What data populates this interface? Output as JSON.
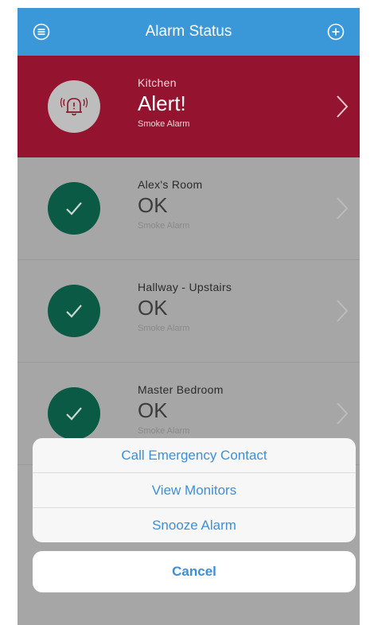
{
  "header": {
    "title": "Alarm Status",
    "left_icon": "menu-icon",
    "right_icon": "add-icon",
    "color": "#3a98d8"
  },
  "alarms": [
    {
      "room": "Kitchen",
      "status": "Alert!",
      "type": "Smoke Alarm",
      "state": "alert",
      "icon": "ringing-bell-icon",
      "color": "#94132e"
    },
    {
      "room": "Alex's Room",
      "status": "OK",
      "type": "Smoke Alarm",
      "state": "ok",
      "icon": "checkmark-icon",
      "color": "#0a5a45"
    },
    {
      "room": "Hallway - Upstairs",
      "status": "OK",
      "type": "Smoke Alarm",
      "state": "ok",
      "icon": "checkmark-icon",
      "color": "#0a5a45"
    },
    {
      "room": "Master Bedroom",
      "status": "OK",
      "type": "Smoke Alarm",
      "state": "ok",
      "icon": "checkmark-icon",
      "color": "#0a5a45"
    }
  ],
  "action_sheet": {
    "items": [
      "Call Emergency Contact",
      "View Monitors",
      "Snooze Alarm"
    ],
    "cancel": "Cancel",
    "accent": "#3d8fd9"
  }
}
